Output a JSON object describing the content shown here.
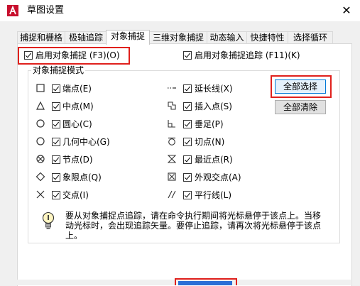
{
  "window": {
    "title": "草图设置"
  },
  "tabs": [
    {
      "label": "捕捉和栅格",
      "active": false
    },
    {
      "label": "极轴追踪",
      "active": false
    },
    {
      "label": "对象捕捉",
      "active": true
    },
    {
      "label": "三维对象捕捉",
      "active": false
    },
    {
      "label": "动态输入",
      "active": false
    },
    {
      "label": "快捷特性",
      "active": false
    },
    {
      "label": "选择循环",
      "active": false
    }
  ],
  "top_options": {
    "enable_osnap": "启用对象捕捉 (F3)(O)",
    "enable_tracking": "启用对象捕捉追踪 (F11)(K)"
  },
  "group": {
    "legend": "对象捕捉模式",
    "left_modes": [
      "端点(E)",
      "中点(M)",
      "圆心(C)",
      "几何中心(G)",
      "节点(D)",
      "象限点(Q)",
      "交点(I)"
    ],
    "right_modes": [
      "延长线(X)",
      "插入点(S)",
      "垂足(P)",
      "切点(N)",
      "最近点(R)",
      "外观交点(A)",
      "平行线(L)"
    ],
    "select_all": "全部选择",
    "clear_all": "全部清除"
  },
  "info": {
    "text": "要从对象捕捉点追踪，请在命令执行期间将光标悬停于该点上。当移动光标时，会出现追踪矢量。要停止追踪，请再次将光标悬停于该点上。"
  },
  "colors": {
    "highlight": "#e0201c",
    "accent": "#0078d7"
  }
}
